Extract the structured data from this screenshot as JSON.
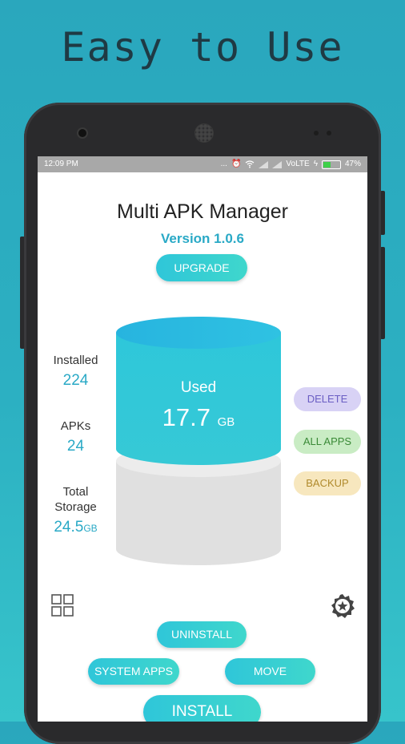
{
  "headline": "Easy to Use",
  "status_bar": {
    "time": "12:09 PM",
    "dots": "...",
    "network": "VoLTE",
    "battery": "47%",
    "battery_level": 0.47
  },
  "app": {
    "title": "Multi APK Manager",
    "version": "Version 1.0.6",
    "upgrade_label": "UPGRADE"
  },
  "stats": {
    "installed_label": "Installed",
    "installed_value": "224",
    "apks_label": "APKs",
    "apks_value": "24",
    "total_label_line1": "Total",
    "total_label_line2": "Storage",
    "total_value": "24.5",
    "total_unit": "GB"
  },
  "storage": {
    "used_label": "Used",
    "used_value": "17.7",
    "used_unit": "GB",
    "used_fraction": 0.72
  },
  "actions": {
    "delete": "DELETE",
    "all_apps": "ALL APPS",
    "backup": "BACKUP",
    "uninstall": "UNINSTALL",
    "system_apps": "SYSTEM APPS",
    "move": "MOVE",
    "install": "INSTALL"
  },
  "icons": {
    "grid": "grid-icon",
    "settings": "settings-star-icon"
  },
  "colors": {
    "accent": "#29a9c6",
    "delete_bg": "#d8d2f5",
    "delete_text": "#6b5fc4",
    "allapps_bg": "#c9ecc4",
    "allapps_text": "#3a8a37",
    "backup_bg": "#f7e7be",
    "backup_text": "#b08a2c"
  }
}
